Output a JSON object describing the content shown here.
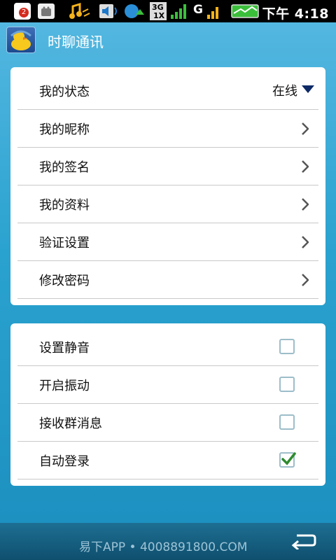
{
  "status_bar": {
    "notification_count": "2",
    "network_3g": "3G",
    "network_1x": "1X",
    "network_g": "G",
    "time": "下午 4:18",
    "icons": [
      "notification-badge-icon",
      "android-icon",
      "music-icon",
      "volume-icon",
      "sync-icon",
      "signal-3g-icon",
      "signal-g-icon",
      "battery-icon"
    ]
  },
  "header": {
    "title": "时聊通讯",
    "icon": "duck-app-icon"
  },
  "settings": {
    "status": {
      "label": "我的状态",
      "value": "在线"
    },
    "nickname": {
      "label": "我的昵称"
    },
    "signature": {
      "label": "我的签名"
    },
    "profile": {
      "label": "我的资料"
    },
    "verification": {
      "label": "验证设置"
    },
    "password": {
      "label": "修改密码"
    }
  },
  "toggles": {
    "mute": {
      "label": "设置静音",
      "checked": false
    },
    "vibrate": {
      "label": "开启振动",
      "checked": false
    },
    "group_messages": {
      "label": "接收群消息",
      "checked": false
    },
    "auto_login": {
      "label": "自动登录",
      "checked": true
    }
  },
  "footer": {
    "text": "易下APP • 4008891800.COM",
    "back_icon": "back-arrow-icon"
  },
  "colors": {
    "accent_check": "#2e8b2e",
    "background_top": "#57b9e2",
    "background_bottom": "#1b8fbf",
    "dropdown_arrow": "#0d2a66"
  }
}
